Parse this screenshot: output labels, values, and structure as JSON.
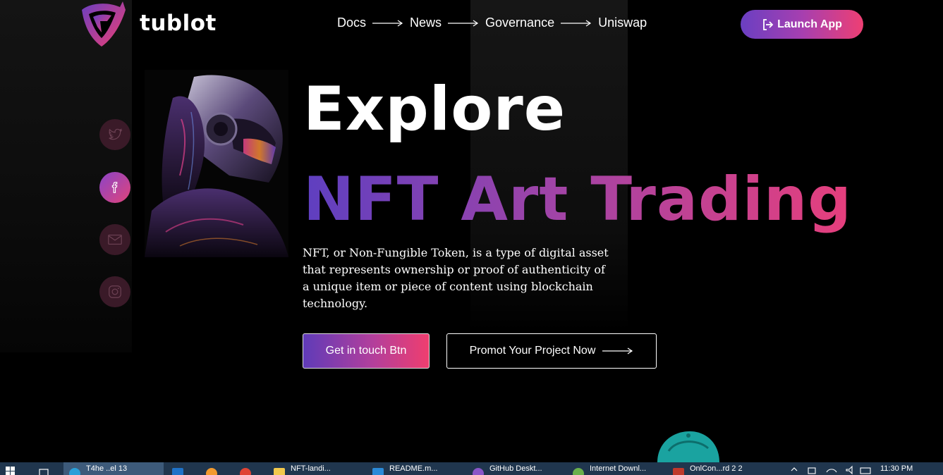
{
  "header": {
    "brand": "tublot",
    "nav": [
      "Docs",
      "News",
      "Governance",
      "Uniswap"
    ],
    "launch_label": "Launch App"
  },
  "social": [
    "twitter-icon",
    "facebook-icon",
    "mail-icon",
    "instagram-icon"
  ],
  "hero": {
    "title": "Explore",
    "subtitle": "NFT Art Trading",
    "description": "NFT, or Non-Fungible Token, is a type of digital asset that represents ownership or proof of authenticity of a unique item or piece of content using blockchain technology.",
    "primary_button": "Get in touch Btn",
    "secondary_button": "Promot Your Project Now"
  },
  "colors": {
    "accent_start": "#5e3fc0",
    "accent_mid": "#a044a8",
    "accent_end": "#ee3f73",
    "background": "#000000",
    "taskbar": "#20364e"
  },
  "taskbar": {
    "items": [
      "T4he ..el 13",
      "",
      "",
      "",
      "NFT-landi...",
      "README.m...",
      "GitHub Deskt...",
      "Internet Downl...",
      "OnlCon...rd 2 2"
    ],
    "clock": "11:30 PM"
  }
}
